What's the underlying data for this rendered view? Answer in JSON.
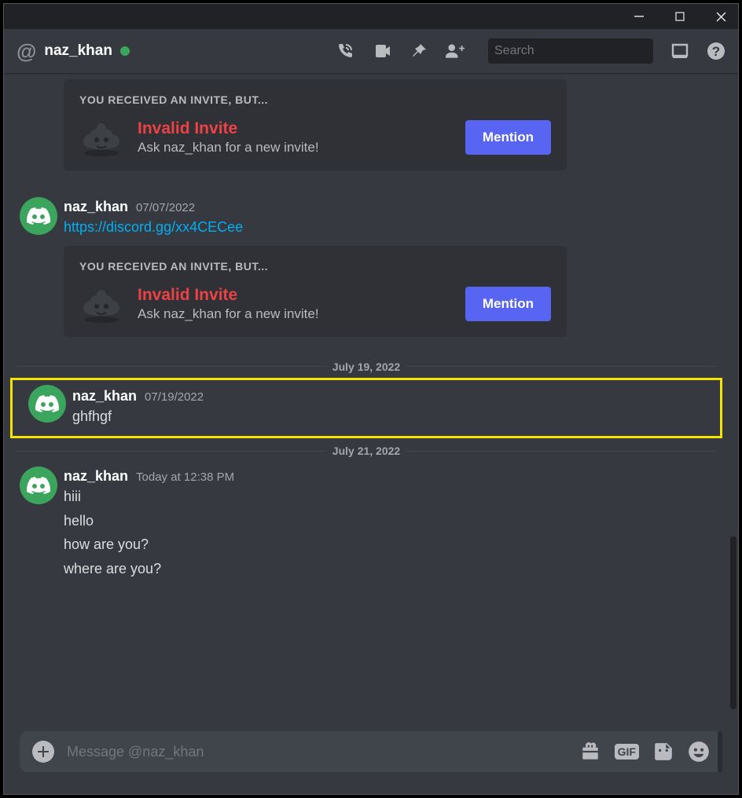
{
  "header": {
    "channel_name": "naz_khan",
    "search_placeholder": "Search"
  },
  "invite": {
    "title": "YOU RECEIVED AN INVITE, BUT...",
    "invalid_label": "Invalid Invite",
    "ask_text": "Ask naz_khan for a new invite!",
    "button_label": "Mention"
  },
  "messages": [
    {
      "author": "naz_khan",
      "timestamp": "07/07/2022",
      "link": "https://discord.gg/xx4CECee",
      "has_invite": true
    },
    {
      "author": "naz_khan",
      "timestamp": "07/19/2022",
      "lines": [
        "ghfhgf"
      ]
    },
    {
      "author": "naz_khan",
      "timestamp": "Today at 12:38 PM",
      "lines": [
        "hiii",
        "hello",
        "how are you?",
        "where are you?"
      ]
    }
  ],
  "dividers": [
    "July 19, 2022",
    "July 21, 2022"
  ],
  "composer": {
    "placeholder": "Message @naz_khan",
    "gif_label": "GIF"
  }
}
